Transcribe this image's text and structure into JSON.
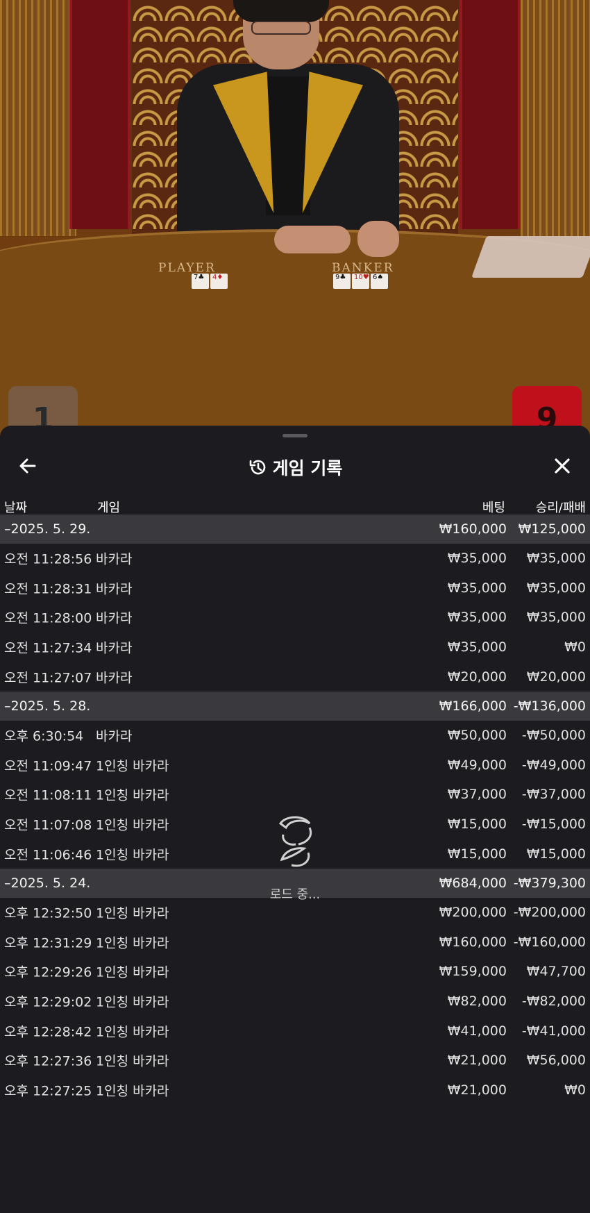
{
  "video": {
    "player_label": "PLAYER",
    "banker_label": "BANKER",
    "player_cards": [
      {
        "rank": "7",
        "suit": "♣",
        "color": "black"
      },
      {
        "rank": "4",
        "suit": "♦",
        "color": "red"
      }
    ],
    "banker_cards": [
      {
        "rank": "9",
        "suit": "♣",
        "color": "black"
      },
      {
        "rank": "10",
        "suit": "♥",
        "color": "red"
      },
      {
        "rank": "6",
        "suit": "♠",
        "color": "black"
      }
    ],
    "player_score": "1",
    "banker_score": "9"
  },
  "panel": {
    "title": "게임 기록",
    "title_icon": "history-icon",
    "back_icon": "arrow-left-icon",
    "close_icon": "close-icon",
    "columns": {
      "date": "날짜",
      "game": "게임",
      "bet": "베팅",
      "result": "승리/패배"
    },
    "loading_text": "로드 중...",
    "groups": [
      {
        "date": "–2025. 5. 29.",
        "bet": "₩160,000",
        "result": "₩125,000",
        "rows": [
          {
            "time": "오전 11:28:56",
            "game": "바카라",
            "bet": "₩35,000",
            "result": "₩35,000"
          },
          {
            "time": "오전 11:28:31",
            "game": "바카라",
            "bet": "₩35,000",
            "result": "₩35,000"
          },
          {
            "time": "오전 11:28:00",
            "game": "바카라",
            "bet": "₩35,000",
            "result": "₩35,000"
          },
          {
            "time": "오전 11:27:34",
            "game": "바카라",
            "bet": "₩35,000",
            "result": "₩0"
          },
          {
            "time": "오전 11:27:07",
            "game": "바카라",
            "bet": "₩20,000",
            "result": "₩20,000"
          }
        ]
      },
      {
        "date": "–2025. 5. 28.",
        "bet": "₩166,000",
        "result": "-₩136,000",
        "rows": [
          {
            "time": "오후 6:30:54",
            "game": "바카라",
            "bet": "₩50,000",
            "result": "-₩50,000"
          },
          {
            "time": "오전 11:09:47",
            "game": "1인칭 바카라",
            "bet": "₩49,000",
            "result": "-₩49,000"
          },
          {
            "time": "오전 11:08:11",
            "game": "1인칭 바카라",
            "bet": "₩37,000",
            "result": "-₩37,000"
          },
          {
            "time": "오전 11:07:08",
            "game": "1인칭 바카라",
            "bet": "₩15,000",
            "result": "-₩15,000"
          },
          {
            "time": "오전 11:06:46",
            "game": "1인칭 바카라",
            "bet": "₩15,000",
            "result": "₩15,000"
          }
        ]
      },
      {
        "date": "–2025. 5. 24.",
        "bet": "₩684,000",
        "result": "-₩379,300",
        "rows": [
          {
            "time": "오후 12:32:50",
            "game": "1인칭 바카라",
            "bet": "₩200,000",
            "result": "-₩200,000"
          },
          {
            "time": "오후 12:31:29",
            "game": "1인칭 바카라",
            "bet": "₩160,000",
            "result": "-₩160,000"
          },
          {
            "time": "오후 12:29:26",
            "game": "1인칭 바카라",
            "bet": "₩159,000",
            "result": "₩47,700"
          },
          {
            "time": "오후 12:29:02",
            "game": "1인칭 바카라",
            "bet": "₩82,000",
            "result": "-₩82,000"
          },
          {
            "time": "오후 12:28:42",
            "game": "1인칭 바카라",
            "bet": "₩41,000",
            "result": "-₩41,000"
          },
          {
            "time": "오후 12:27:36",
            "game": "1인칭 바카라",
            "bet": "₩21,000",
            "result": "₩56,000"
          },
          {
            "time": "오후 12:27:25",
            "game": "1인칭 바카라",
            "bet": "₩21,000",
            "result": "₩0"
          }
        ]
      }
    ]
  },
  "colors": {
    "panel_bg": "#1c1b1f",
    "group_bg": "#3a393e",
    "banker_red": "#c0101b"
  }
}
